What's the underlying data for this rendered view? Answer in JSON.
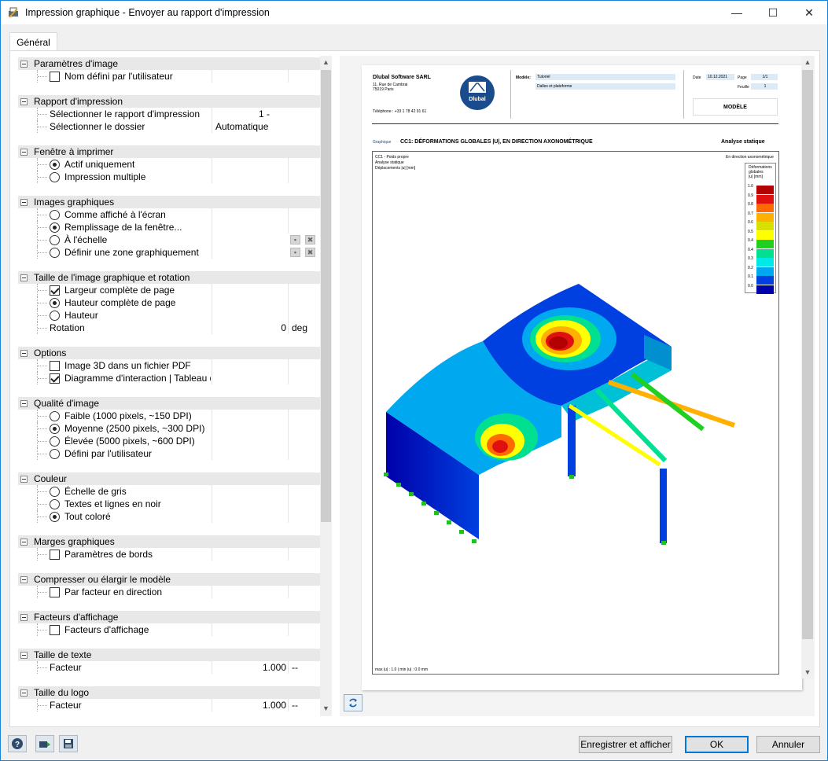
{
  "window": {
    "title": "Impression graphique - Envoyer au rapport d'impression",
    "minimize": "—",
    "maximize": "☐",
    "close": "✕"
  },
  "tabs": [
    {
      "label": "Général"
    }
  ],
  "tree": {
    "g1": {
      "label": "Paramètres d'image",
      "item1": "Nom défini par l'utilisateur"
    },
    "g2": {
      "label": "Rapport d'impression",
      "item1": "Sélectionner le rapport d'impression",
      "item1_value": "1 -",
      "item2": "Sélectionner le dossier",
      "item2_value": "Automatique"
    },
    "g3": {
      "label": "Fenêtre à imprimer",
      "item1": "Actif uniquement",
      "item2": "Impression multiple"
    },
    "g4": {
      "label": "Images graphiques",
      "item1": "Comme affiché à l'écran",
      "item2": "Remplissage de la fenêtre...",
      "item3": "À l'échelle",
      "item4": "Définir une zone graphiquement"
    },
    "g5": {
      "label": "Taille de l'image graphique et rotation",
      "item1": "Largeur complète de page",
      "item2": "Hauteur complète de page",
      "item3": "Hauteur",
      "item4": "Rotation",
      "item4_value": "0",
      "item4_unit": "deg"
    },
    "g6": {
      "label": "Options",
      "item1": "Image 3D dans un fichier PDF",
      "item2": "Diagramme d'interaction | Tableau d"
    },
    "g7": {
      "label": "Qualité d'image",
      "item1": "Faible (1000 pixels, ~150 DPI)",
      "item2": "Moyenne (2500 pixels, ~300 DPI)",
      "item3": "Élevée (5000 pixels, ~600 DPI)",
      "item4": "Défini par l'utilisateur"
    },
    "g8": {
      "label": "Couleur",
      "item1": "Échelle de gris",
      "item2": "Textes et lignes en noir",
      "item3": "Tout coloré"
    },
    "g9": {
      "label": "Marges graphiques",
      "item1": "Paramètres de bords"
    },
    "g10": {
      "label": "Compresser ou élargir le modèle",
      "item1": "Par facteur en direction"
    },
    "g11": {
      "label": "Facteurs d'affichage",
      "item1": "Facteurs d'affichage"
    },
    "g12": {
      "label": "Taille de texte",
      "item1": "Facteur",
      "item1_value": "1.000",
      "item1_unit": "--"
    },
    "g13": {
      "label": "Taille du logo",
      "item1": "Facteur",
      "item1_value": "1.000",
      "item1_unit": "--"
    }
  },
  "preview": {
    "company": "Dlubal Software SARL",
    "address1": "11, Rue de Cambrai",
    "address2": "75019 Paris",
    "phone": "Téléphone : +33 1 78 42 91 61",
    "logo_text": "Dlubal",
    "model_label": "Modèle:",
    "model_value": "Tutoriel",
    "model_sub": "Dalles et plateforme",
    "date_label": "Date",
    "date_value": "10.12.2021",
    "page_label": "Page",
    "page_value": "1/1",
    "sheet_label": "Feuille",
    "sheet_value": "1",
    "section_box": "MODÈLE",
    "graph_tag": "Graphique",
    "heading": "CC1: DÉFORMATIONS GLOBALES |U|, EN DIRECTION AXONOMÉTRIQUE",
    "analysis": "Analyse statique",
    "info1": "CC1 - Poids propre",
    "info2": "Analyse statique",
    "info3": "Déplacements |u| [mm]",
    "direction": "En direction axonométrique",
    "legend_title1": "Déformations",
    "legend_title2": "globales",
    "legend_title3": "|u| [mm]",
    "legend_values": [
      "1.0",
      "0.9",
      "0.8",
      "0.7",
      "0.6",
      "0.5",
      "0.4",
      "0.4",
      "0.3",
      "0.2",
      "0.1",
      "0.0"
    ],
    "legend_colors": [
      "#b30000",
      "#e01010",
      "#ff6a00",
      "#ffb000",
      "#d8e000",
      "#ffff00",
      "#20d020",
      "#00e090",
      "#00e8e8",
      "#00a8f0",
      "#0040e0",
      "#0000a8"
    ],
    "footer_note": "max |u| : 1.0 | min |u| : 0.0 mm"
  },
  "buttons": {
    "save_show": "Enregistrer et afficher",
    "ok": "OK",
    "cancel": "Annuler"
  }
}
